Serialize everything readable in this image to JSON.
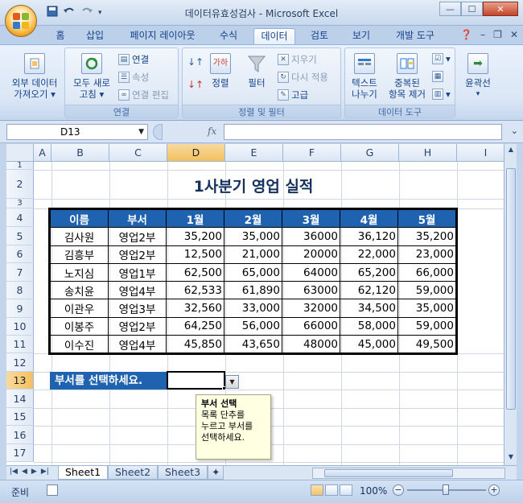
{
  "window": {
    "title": "데이터유효성검사 - Microsoft Excel"
  },
  "quick_access": {
    "save_icon": "save-icon",
    "undo_icon": "undo-icon",
    "redo_icon": "redo-icon"
  },
  "ribbon_tabs": [
    {
      "label": "홈",
      "active": false
    },
    {
      "label": "삽입",
      "active": false
    },
    {
      "label": "페이지 레이아웃",
      "active": false
    },
    {
      "label": "수식",
      "active": false
    },
    {
      "label": "데이터",
      "active": true
    },
    {
      "label": "검토",
      "active": false
    },
    {
      "label": "보기",
      "active": false
    },
    {
      "label": "개발 도구",
      "active": false
    }
  ],
  "ribbon": {
    "get_external": {
      "line1": "외부 데이터",
      "line2": "가져오기"
    },
    "refresh_all": {
      "line1": "모두 새로",
      "line2": "고침"
    },
    "connections": "연결",
    "properties": "속성",
    "edit_links": "연결 편집",
    "group_connections": "연결",
    "sort": "정렬",
    "filter": "필터",
    "clear": "지우기",
    "reapply": "다시 적용",
    "advanced": "고급",
    "group_sort_filter": "정렬 및 필터",
    "text_to_columns": {
      "line1": "텍스트",
      "line2": "나누기"
    },
    "remove_duplicates": {
      "line1": "중복된",
      "line2": "항목 제거"
    },
    "group_data_tools": "데이터 도구",
    "outline": "윤곽선"
  },
  "formula_bar": {
    "name_box": "D13",
    "fx": "fx",
    "formula": ""
  },
  "columns": [
    "A",
    "B",
    "C",
    "D",
    "E",
    "F",
    "G",
    "H",
    "I"
  ],
  "selected_column": "D",
  "rows": [
    "1",
    "2",
    "3",
    "4",
    "5",
    "6",
    "7",
    "8",
    "9",
    "10",
    "11",
    "12",
    "13",
    "14",
    "15",
    "16",
    "17"
  ],
  "selected_row": "13",
  "sheet": {
    "title": "1사분기 영업 실적",
    "headers": [
      "이름",
      "부서",
      "1월",
      "2월",
      "3월",
      "4월",
      "5월"
    ],
    "records": [
      [
        "김사원",
        "영업2부",
        "35,200",
        "35,000",
        "36000",
        "36,120",
        "35,200"
      ],
      [
        "김흥부",
        "영업2부",
        "12,500",
        "21,000",
        "20000",
        "22,000",
        "23,000"
      ],
      [
        "노지심",
        "영업1부",
        "62,500",
        "65,000",
        "64000",
        "65,200",
        "66,000"
      ],
      [
        "송치윤",
        "영업4부",
        "62,533",
        "61,890",
        "63000",
        "62,120",
        "59,000"
      ],
      [
        "이관우",
        "영업3부",
        "32,560",
        "33,000",
        "32000",
        "34,500",
        "35,000"
      ],
      [
        "이봉주",
        "영업2부",
        "64,250",
        "56,000",
        "66000",
        "58,000",
        "59,000"
      ],
      [
        "이수진",
        "영업4부",
        "45,850",
        "43,650",
        "48000",
        "45,000",
        "49,500"
      ]
    ],
    "prompt_label": "부서를 선택하세요.",
    "active_cell_value": ""
  },
  "validation_tooltip": {
    "title": "부서 선택",
    "lines": [
      "목록 단추를",
      "누르고 부서를",
      "선택하세요."
    ]
  },
  "sheet_tabs": [
    {
      "label": "Sheet1",
      "active": true
    },
    {
      "label": "Sheet2",
      "active": false
    },
    {
      "label": "Sheet3",
      "active": false
    }
  ],
  "status": {
    "ready": "준비",
    "zoom": "100%"
  }
}
